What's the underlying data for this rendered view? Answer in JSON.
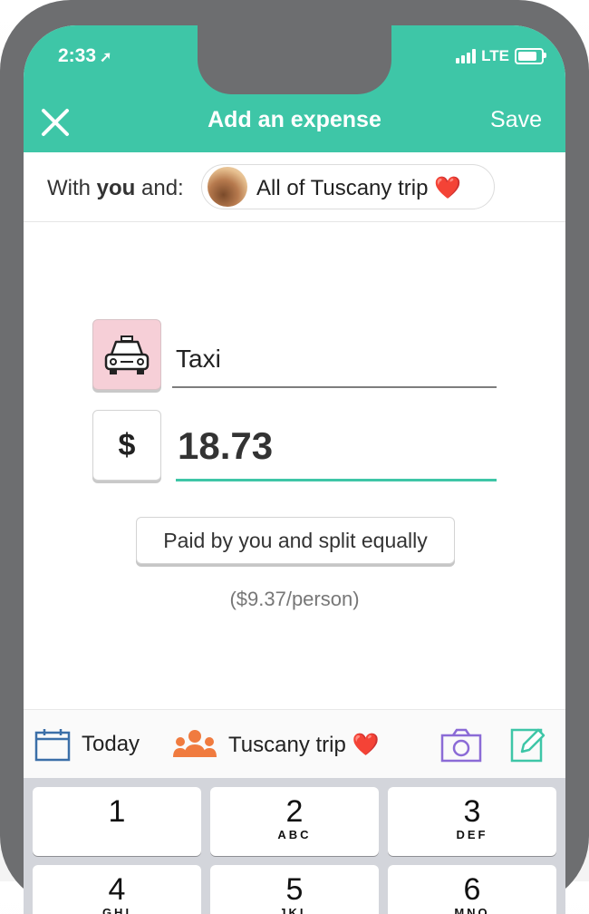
{
  "status_bar": {
    "time": "2:33",
    "network": "LTE"
  },
  "header": {
    "title": "Add an expense",
    "save_label": "Save"
  },
  "with_row": {
    "prefix": "With ",
    "bold": "you",
    "suffix": " and:",
    "group_name": "All of Tuscany trip",
    "group_emoji": "❤️"
  },
  "expense": {
    "category_icon": "taxi-icon",
    "description": "Taxi",
    "currency_symbol": "$",
    "amount": "18.73"
  },
  "split": {
    "button_label": "Paid by you and split equally",
    "per_person": "($9.37/person)"
  },
  "bottom_bar": {
    "date_label": "Today",
    "group_label": "Tuscany trip",
    "group_emoji": "❤️"
  },
  "keyboard": {
    "keys": [
      {
        "number": "1",
        "letters": ""
      },
      {
        "number": "2",
        "letters": "ABC"
      },
      {
        "number": "3",
        "letters": "DEF"
      },
      {
        "number": "4",
        "letters": "GHI"
      },
      {
        "number": "5",
        "letters": "JKL"
      },
      {
        "number": "6",
        "letters": "MNO"
      }
    ]
  },
  "colors": {
    "accent": "#3ec6a7",
    "category_bg": "#f6cfd7",
    "heart": "#e0292f",
    "camera": "#8b6bd6",
    "group_icon": "#f07b3f",
    "calendar": "#3b6fa8"
  }
}
